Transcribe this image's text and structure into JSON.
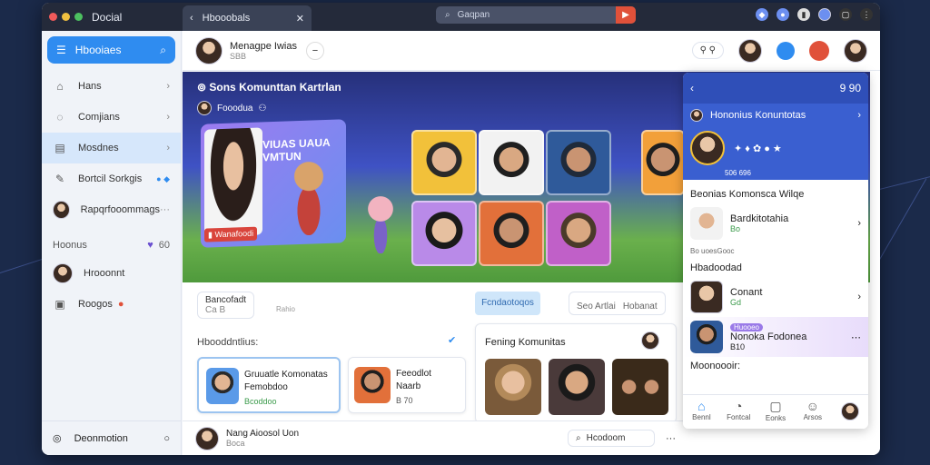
{
  "app": {
    "name": "Docial"
  },
  "tab": {
    "label": "Hbooobals"
  },
  "address": {
    "placeholder": "Gaqpan"
  },
  "sidebar": {
    "header": "Hbooiaes",
    "items": [
      {
        "label": "Hans"
      },
      {
        "label": "Comjians"
      },
      {
        "label": "Mosdnes"
      },
      {
        "label": "Bortcil Sorkgis"
      },
      {
        "label": "Rapqrfooommags"
      }
    ],
    "section": "Hoonus",
    "section_badge": "60",
    "people": [
      {
        "label": "Hrooonnt"
      },
      {
        "label": "Roogos"
      }
    ],
    "footer": "Deonmotion"
  },
  "topbar": {
    "title": "Menagpe Iwias",
    "subtitle": "SBB"
  },
  "hero": {
    "title": "Sons Komunttan Kartrlan",
    "subtitle": "Fooodua",
    "card_text": "VIUAS UAUA VMTUN",
    "card_badge": "Wanafoodi"
  },
  "lower": {
    "filter_label": "Bancofadt",
    "filter_sub": "Ca B",
    "filter_chip": "Rahio",
    "section_label": "Hbooddntlius:",
    "card1_title": "Gruuatle Komonatas",
    "card1_sub": "Femobdoo",
    "card1_meta": "Bcoddoo",
    "card2_title": "Feeodlot",
    "card2_sub": "Naarb",
    "card2_meta": "B 70",
    "tab_active": "Fcndaotoqos",
    "tab_other": "Seo Artlai",
    "tab_other2": "Hobanat",
    "community_title": "Fening Komunitas"
  },
  "bottombar": {
    "title": "Nang Aioosol Uon",
    "subtitle": "Boca",
    "search": "Hcodoom"
  },
  "panel": {
    "header_title": "",
    "header_code": "9 90",
    "title": "Hononius Konuntotas",
    "meta": "506 696",
    "section1": "Beonias Komonsca Wilqe",
    "row1_title": "Bardkitotahia",
    "row1_sub": "Bo",
    "meta2": "Bo uoesGooc",
    "section2": "Hbadoodad",
    "row2_title": "Conant",
    "row2_sub": "Gd",
    "row3_tag": "Huooeo",
    "row3_title": "Nonoka Fodonea",
    "row3_sub": "B10",
    "section3": "Moonoooir:",
    "nav": [
      "Bennl",
      "Fontcal",
      "Eonks",
      "Arsos"
    ]
  },
  "colors": {
    "accent": "#2f8cf0",
    "titlebar": "#242a3a",
    "hero_top": "#26307a",
    "red": "#e0513a"
  }
}
